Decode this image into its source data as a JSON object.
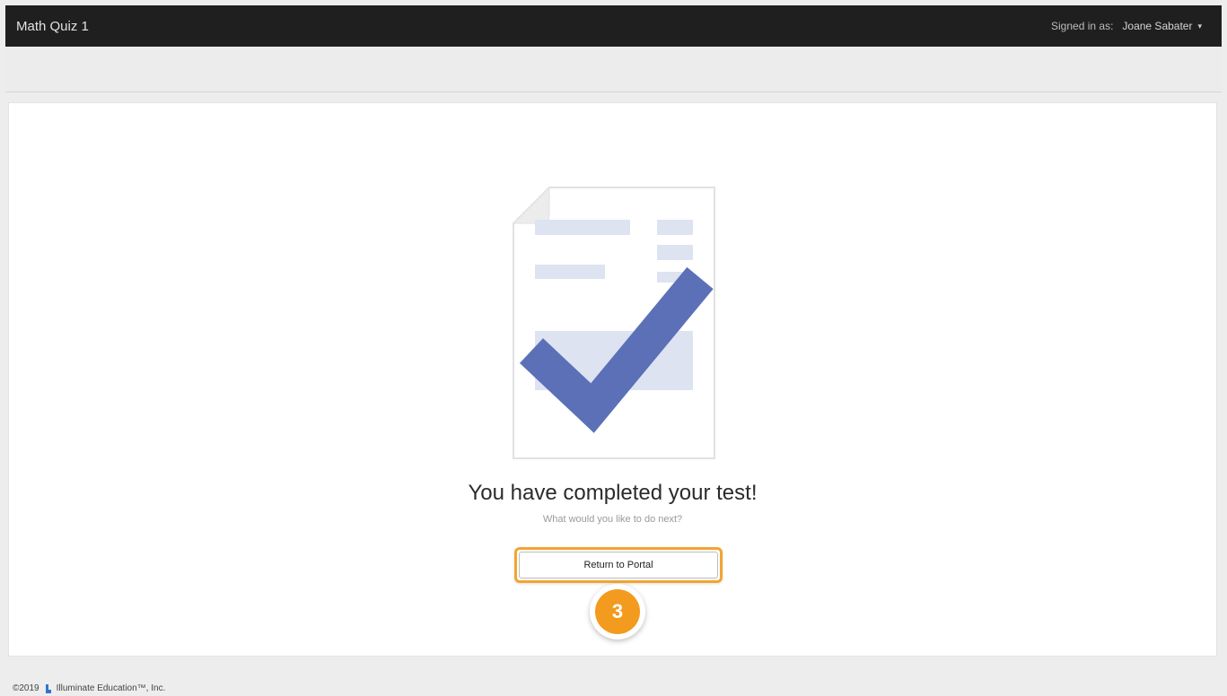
{
  "header": {
    "app_title": "Math Quiz 1",
    "signed_in_label": "Signed in as:",
    "user_name": "Joane Sabater",
    "caret": "▾"
  },
  "completion": {
    "heading": "You have completed your test!",
    "subheading": "What would you like to do next?",
    "return_button_label": "Return to Portal",
    "step_number": "3"
  },
  "footer": {
    "year": "©2019",
    "company": "Illuminate Education™, Inc."
  },
  "colors": {
    "topbar": "#1f1f1f",
    "check_accent": "#5b70b7",
    "highlight": "#f2a531",
    "badge": "#f29b1f"
  },
  "icons": {
    "illustration": "document-checkmark-icon",
    "footer_logo": "illuminate-logo-icon"
  }
}
